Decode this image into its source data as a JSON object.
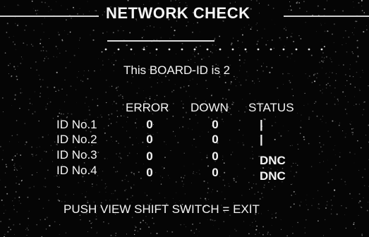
{
  "screen": {
    "title": "NETWORK CHECK",
    "board_id_text": "This BOARD-ID is 2",
    "columns": {
      "error": "ERROR",
      "down": "DOWN",
      "status": "STATUS"
    },
    "rows": [
      {
        "id": "ID No.1",
        "error": "0",
        "down": "0",
        "status": "|"
      },
      {
        "id": "ID No.2",
        "error": "0",
        "down": "0",
        "status": "|"
      },
      {
        "id": "ID No.3",
        "error": "0",
        "down": "0",
        "status": "DNC"
      },
      {
        "id": "ID No.4",
        "error": "0",
        "down": "0",
        "status": "DNC"
      }
    ],
    "footer": "PUSH VIEW SHIFT SWITCH = EXIT"
  },
  "colors": {
    "background": "#050505",
    "text": "#f4f4f4"
  }
}
